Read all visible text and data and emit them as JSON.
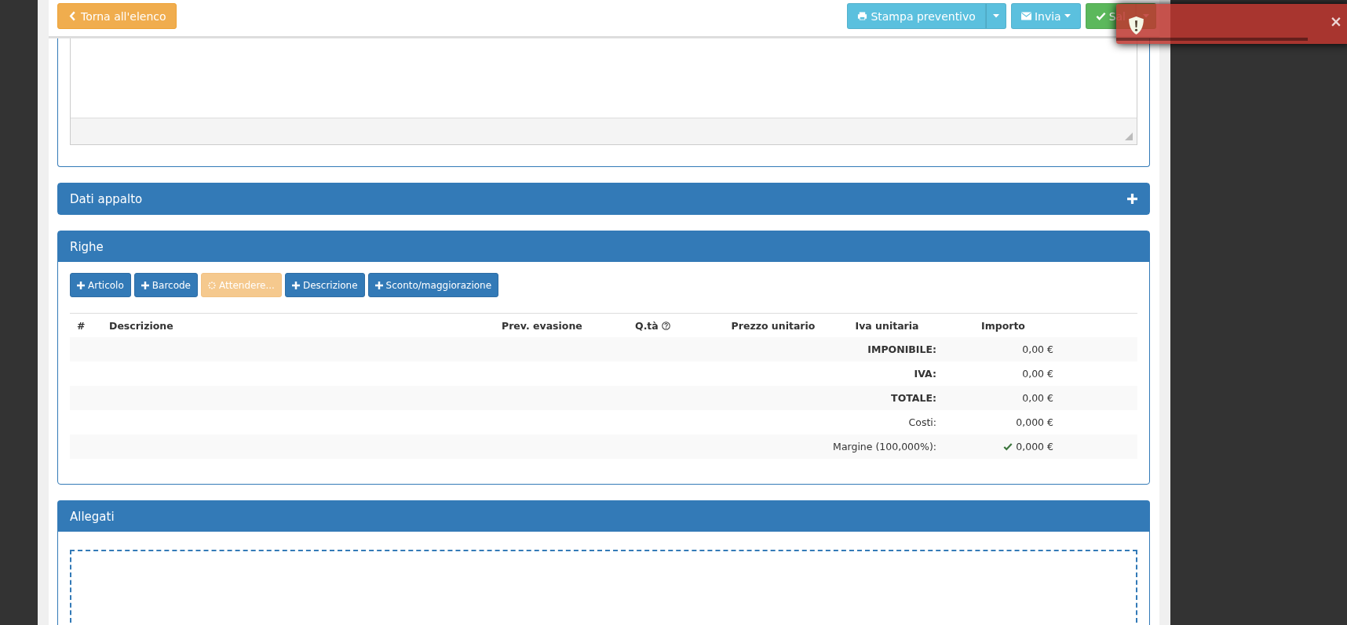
{
  "toolbar": {
    "back_button": "Torna all'elenco",
    "actions": [
      {
        "kind": "split",
        "label": "Stampa preventivo",
        "color": "#5bc0de"
      },
      {
        "kind": "dropdown",
        "label": "Invia",
        "color": "#5bc0de"
      },
      {
        "kind": "split",
        "label": "Sal",
        "color": "#5cb85c"
      }
    ]
  },
  "toast": {
    "kind": "error",
    "close": "×",
    "level": 0.82
  },
  "panels": [
    {
      "kind": "notes"
    },
    {
      "kind": "collapsed",
      "title": "Dati appalto",
      "expanded": false
    },
    {
      "kind": "rows",
      "title": "Righe",
      "expanded": true,
      "buttons": [
        {
          "kind": "add",
          "label": "Articolo"
        },
        {
          "kind": "add",
          "label": "Barcode"
        },
        {
          "kind": "loading",
          "label": "Attendere..."
        },
        {
          "kind": "add",
          "label": "Descrizione"
        },
        {
          "kind": "add",
          "label": "Sconto/maggiorazione"
        }
      ],
      "columns": [
        {
          "label": "#",
          "help": false
        },
        {
          "label": "Descrizione",
          "help": false
        },
        {
          "label": "Prev. evasione",
          "help": false
        },
        {
          "label": "Q.tà",
          "help": true
        },
        {
          "label": "Prezzo unitario",
          "help": false
        },
        {
          "label": "Iva unitaria",
          "help": false
        },
        {
          "label": "Importo",
          "help": false
        }
      ],
      "totals": [
        {
          "label": "IMPONIBILE:",
          "value": "0,00 €",
          "bold": true,
          "ok": false
        },
        {
          "label": "IVA:",
          "value": "0,00 €",
          "bold": true,
          "ok": false
        },
        {
          "label": "TOTALE:",
          "value": "0,00 €",
          "bold": true,
          "ok": false
        },
        {
          "label": "Costi:",
          "value": "0,000 €",
          "bold": false,
          "ok": false
        },
        {
          "label": "Margine (100,000%):",
          "value": "0,000 €",
          "bold": false,
          "ok": true
        }
      ]
    },
    {
      "kind": "attachments",
      "title": "Allegati"
    }
  ]
}
